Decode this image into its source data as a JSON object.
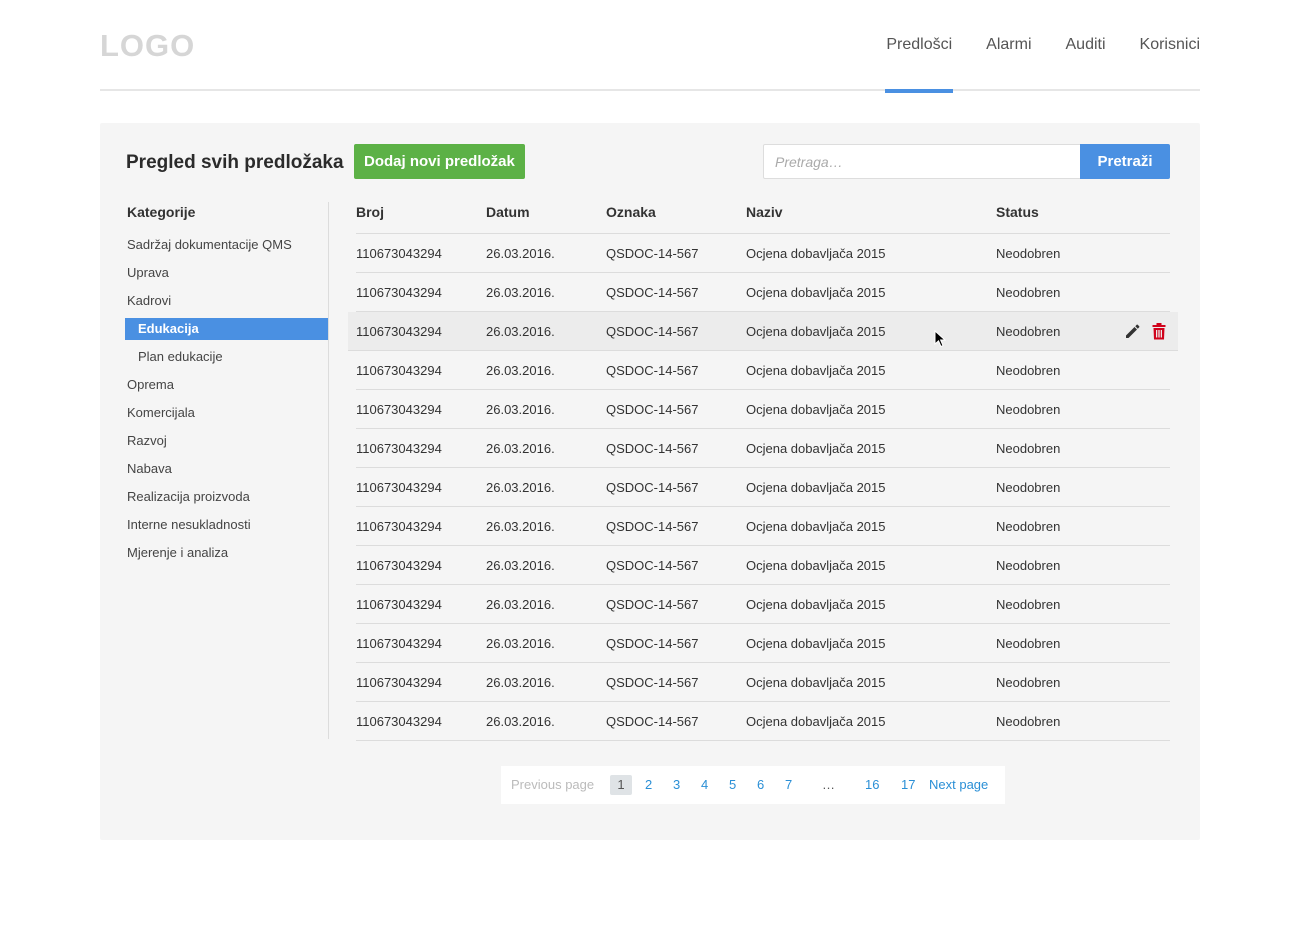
{
  "header": {
    "logo": "LOGO",
    "nav": [
      {
        "label": "Predlošci",
        "active": true
      },
      {
        "label": "Alarmi",
        "active": false
      },
      {
        "label": "Auditi",
        "active": false
      },
      {
        "label": "Korisnici",
        "active": false
      }
    ]
  },
  "panel": {
    "title": "Pregled svih predložaka",
    "add_button": "Dodaj novi predložak",
    "search_placeholder": "Pretraga…",
    "search_button": "Pretraži"
  },
  "sidebar": {
    "title": "Kategorije",
    "items": [
      {
        "label": "Sadržaj dokumentacije QMS",
        "level": 0,
        "active": false
      },
      {
        "label": "Uprava",
        "level": 0,
        "active": false
      },
      {
        "label": "Kadrovi",
        "level": 0,
        "active": false
      },
      {
        "label": "Edukacija",
        "level": 1,
        "active": true
      },
      {
        "label": "Plan edukacije",
        "level": 1,
        "active": false
      },
      {
        "label": "Oprema",
        "level": 0,
        "active": false
      },
      {
        "label": "Komercijala",
        "level": 0,
        "active": false
      },
      {
        "label": "Razvoj",
        "level": 0,
        "active": false
      },
      {
        "label": "Nabava",
        "level": 0,
        "active": false
      },
      {
        "label": "Realizacija proizvoda",
        "level": 0,
        "active": false
      },
      {
        "label": "Interne nesukladnosti",
        "level": 0,
        "active": false
      },
      {
        "label": "Mjerenje i analiza",
        "level": 0,
        "active": false
      }
    ]
  },
  "table": {
    "columns": [
      "Broj",
      "Datum",
      "Oznaka",
      "Naziv",
      "Status"
    ],
    "hover_row_index": 2,
    "rows": [
      [
        "110673043294",
        "26.03.2016.",
        "QSDOC-14-567",
        "Ocjena dobavljača 2015",
        "Neodobren"
      ],
      [
        "110673043294",
        "26.03.2016.",
        "QSDOC-14-567",
        "Ocjena dobavljača 2015",
        "Neodobren"
      ],
      [
        "110673043294",
        "26.03.2016.",
        "QSDOC-14-567",
        "Ocjena dobavljača 2015",
        "Neodobren"
      ],
      [
        "110673043294",
        "26.03.2016.",
        "QSDOC-14-567",
        "Ocjena dobavljača 2015",
        "Neodobren"
      ],
      [
        "110673043294",
        "26.03.2016.",
        "QSDOC-14-567",
        "Ocjena dobavljača 2015",
        "Neodobren"
      ],
      [
        "110673043294",
        "26.03.2016.",
        "QSDOC-14-567",
        "Ocjena dobavljača 2015",
        "Neodobren"
      ],
      [
        "110673043294",
        "26.03.2016.",
        "QSDOC-14-567",
        "Ocjena dobavljača 2015",
        "Neodobren"
      ],
      [
        "110673043294",
        "26.03.2016.",
        "QSDOC-14-567",
        "Ocjena dobavljača 2015",
        "Neodobren"
      ],
      [
        "110673043294",
        "26.03.2016.",
        "QSDOC-14-567",
        "Ocjena dobavljača 2015",
        "Neodobren"
      ],
      [
        "110673043294",
        "26.03.2016.",
        "QSDOC-14-567",
        "Ocjena dobavljača 2015",
        "Neodobren"
      ],
      [
        "110673043294",
        "26.03.2016.",
        "QSDOC-14-567",
        "Ocjena dobavljača 2015",
        "Neodobren"
      ],
      [
        "110673043294",
        "26.03.2016.",
        "QSDOC-14-567",
        "Ocjena dobavljača 2015",
        "Neodobren"
      ],
      [
        "110673043294",
        "26.03.2016.",
        "QSDOC-14-567",
        "Ocjena dobavljača 2015",
        "Neodobren"
      ]
    ],
    "actions": {
      "edit_icon": "pencil-icon",
      "delete_icon": "trash-icon"
    }
  },
  "pagination": {
    "previous": "Previous page",
    "pages": [
      "1",
      "2",
      "3",
      "4",
      "5",
      "6",
      "7"
    ],
    "ellipsis": "…",
    "tail_pages": [
      "16",
      "17"
    ],
    "next": "Next page",
    "current": "1"
  },
  "colors": {
    "accent": "#4a90e2",
    "add_button": "#5cb146",
    "delete": "#d0021b"
  }
}
